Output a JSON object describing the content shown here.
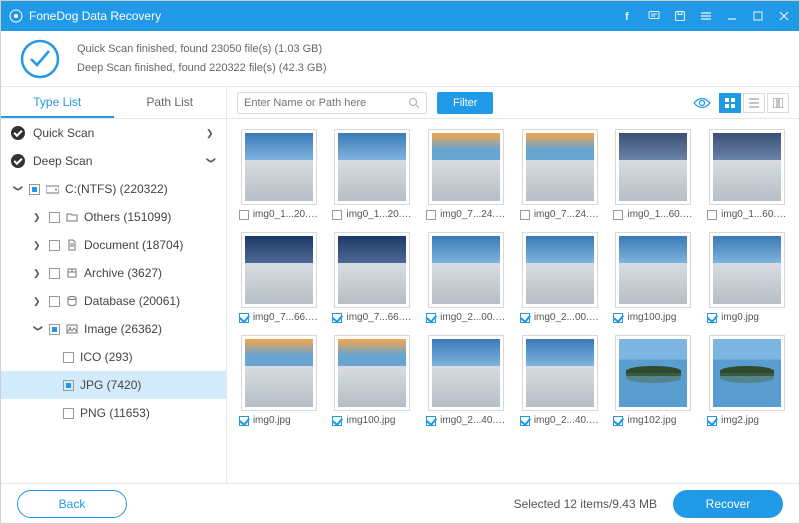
{
  "titlebar": {
    "app_name": "FoneDog Data Recovery"
  },
  "status": {
    "line1": "Quick Scan finished, found 23050 file(s) (1.03 GB)",
    "line2": "Deep Scan finished, found 220322 file(s) (42.3 GB)"
  },
  "tabs": {
    "type_list": "Type List",
    "path_list": "Path List"
  },
  "search": {
    "placeholder": "Enter Name or Path here"
  },
  "filter_label": "Filter",
  "tree": {
    "quick_scan": "Quick Scan",
    "deep_scan": "Deep Scan",
    "drive": "C:(NTFS) (220322)",
    "others": "Others (151099)",
    "document": "Document (18704)",
    "archive": "Archive (3627)",
    "database": "Database (20061)",
    "image": "Image (26362)",
    "ico": "ICO (293)",
    "jpg": "JPG (7420)",
    "png": "PNG (11653)"
  },
  "files": [
    {
      "name": "img0_1...20.jpg",
      "checked": false,
      "style": "blue"
    },
    {
      "name": "img0_1...20.jpg",
      "checked": false,
      "style": "blue"
    },
    {
      "name": "img0_7...24.jpg",
      "checked": false,
      "style": "sunset"
    },
    {
      "name": "img0_7...24.jpg",
      "checked": false,
      "style": "sunset"
    },
    {
      "name": "img0_1...60.jpg",
      "checked": false,
      "style": "dusk"
    },
    {
      "name": "img0_1...60.jpg",
      "checked": false,
      "style": "dusk"
    },
    {
      "name": "img0_7...66.jpg",
      "checked": true,
      "style": "deep"
    },
    {
      "name": "img0_7...66.jpg",
      "checked": true,
      "style": "deep"
    },
    {
      "name": "img0_2...00.jpg",
      "checked": true,
      "style": "blue"
    },
    {
      "name": "img0_2...00.jpg",
      "checked": true,
      "style": "blue"
    },
    {
      "name": "img100.jpg",
      "checked": true,
      "style": "blue"
    },
    {
      "name": "img0.jpg",
      "checked": true,
      "style": "blue"
    },
    {
      "name": "img0.jpg",
      "checked": true,
      "style": "sunset"
    },
    {
      "name": "img100.jpg",
      "checked": true,
      "style": "sunset"
    },
    {
      "name": "img0_2...40.jpg",
      "checked": true,
      "style": "blue"
    },
    {
      "name": "img0_2...40.jpg",
      "checked": true,
      "style": "blue"
    },
    {
      "name": "img102.jpg",
      "checked": true,
      "style": "island"
    },
    {
      "name": "img2.jpg",
      "checked": true,
      "style": "island"
    }
  ],
  "footer": {
    "back": "Back",
    "selection": "Selected 12 items/9.43 MB",
    "recover": "Recover"
  }
}
